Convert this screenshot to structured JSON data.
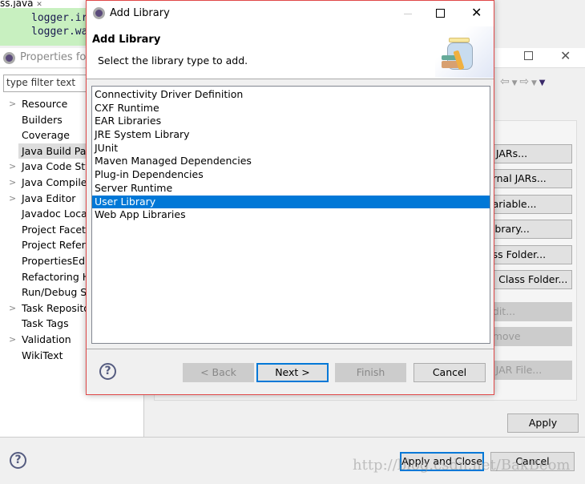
{
  "editor": {
    "tab_label": "ss.java",
    "close_glyph": "✕",
    "code_lines": [
      "logger.ir",
      "logger.wa"
    ]
  },
  "properties": {
    "title": "Properties for",
    "filter_placeholder": "type filter text",
    "tree": [
      {
        "label": "Resource",
        "expandable": true
      },
      {
        "label": "Builders",
        "expandable": false
      },
      {
        "label": "Coverage",
        "expandable": false
      },
      {
        "label": "Java Build Path",
        "expandable": false,
        "selected": true
      },
      {
        "label": "Java Code Style",
        "expandable": true
      },
      {
        "label": "Java Compiler",
        "expandable": true
      },
      {
        "label": "Java Editor",
        "expandable": true
      },
      {
        "label": "Javadoc Location",
        "expandable": false
      },
      {
        "label": "Project Facets",
        "expandable": false
      },
      {
        "label": "Project References",
        "expandable": false
      },
      {
        "label": "PropertiesEditor",
        "expandable": false
      },
      {
        "label": "Refactoring History",
        "expandable": false
      },
      {
        "label": "Run/Debug Settings",
        "expandable": false
      },
      {
        "label": "Task Repository",
        "expandable": true
      },
      {
        "label": "Task Tags",
        "expandable": false
      },
      {
        "label": "Validation",
        "expandable": true
      },
      {
        "label": "WikiText",
        "expandable": false
      }
    ],
    "side_buttons": [
      {
        "label": "d JARs...",
        "enabled": true
      },
      {
        "label": "ernal JARs...",
        "enabled": true
      },
      {
        "label": "Variable...",
        "enabled": true
      },
      {
        "label": "Library...",
        "enabled": true
      },
      {
        "label": "ass Folder...",
        "enabled": true
      },
      {
        "label": "al Class Folder...",
        "enabled": true
      },
      {
        "label": "Edit...",
        "enabled": false
      },
      {
        "label": "emove",
        "enabled": false
      },
      {
        "label": "e JAR File...",
        "enabled": false
      }
    ],
    "apply_label": "Apply",
    "apply_close_label": "Apply and Close",
    "cancel_label": "Cancel",
    "help_glyph": "?"
  },
  "dialog": {
    "window_title": "Add Library",
    "heading": "Add Library",
    "description": "Select the library type to add.",
    "library_types": [
      "Connectivity Driver Definition",
      "CXF Runtime",
      "EAR Libraries",
      "JRE System Library",
      "JUnit",
      "Maven Managed Dependencies",
      "Plug-in Dependencies",
      "Server Runtime",
      "User Library",
      "Web App Libraries"
    ],
    "selected_index": 8,
    "buttons": {
      "back": "< Back",
      "next": "Next >",
      "finish": "Finish",
      "cancel": "Cancel"
    },
    "help_glyph": "?",
    "colors": {
      "selection": "#0078d7",
      "border": "#e04848"
    }
  },
  "watermark": "http://blog.csdn.net/BakBeom"
}
